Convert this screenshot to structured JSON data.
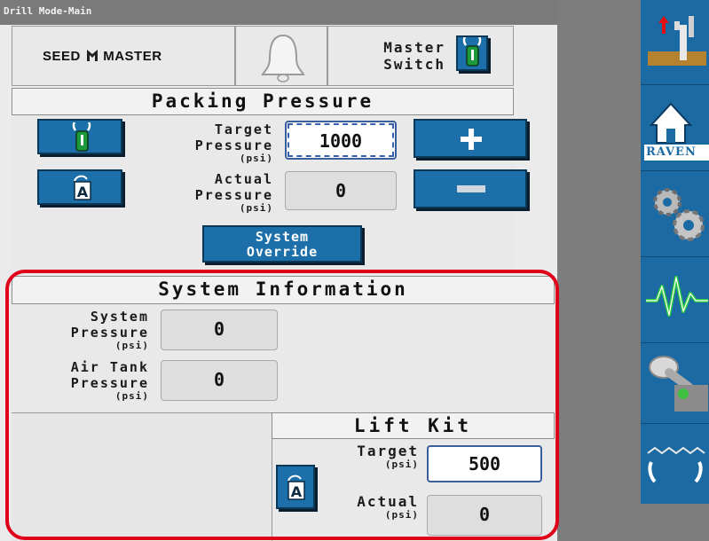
{
  "window": {
    "title": "Drill Mode-Main"
  },
  "header": {
    "brand": "SEEDMASTER",
    "brand_prefix": "SEED",
    "brand_suffix": "MASTER",
    "master_switch_label_line1": "Master",
    "master_switch_label_line2": "Switch"
  },
  "packing": {
    "title": "Packing Pressure",
    "target_label": [
      "Target",
      "Pressure"
    ],
    "target_unit": "(psi)",
    "target_value": "1000",
    "actual_label": [
      "Actual",
      "Pressure"
    ],
    "actual_unit": "(psi)",
    "actual_value": "0",
    "override_line1": "System",
    "override_line2": "Override"
  },
  "system_info": {
    "title": "System Information",
    "system_pressure_label": [
      "System",
      "Pressure"
    ],
    "system_pressure_unit": "(psi)",
    "system_pressure_value": "0",
    "air_tank_label": [
      "Air Tank",
      "Pressure"
    ],
    "air_tank_unit": "(psi)",
    "air_tank_value": "0"
  },
  "lift_kit": {
    "title": "Lift Kit",
    "target_label": "Target",
    "target_unit": "(psi)",
    "target_value": "500",
    "actual_label": "Actual",
    "actual_unit": "(psi)",
    "actual_value": "0"
  },
  "sidebar": {
    "raven_label": "RAVEN",
    "items": [
      "drill-lift-icon",
      "raven-home-icon",
      "gears-icon",
      "diagnostics-icon",
      "joystick-icon",
      "section-control-icon"
    ]
  },
  "colors": {
    "accent_blue": "#1c6fa8",
    "highlight_red": "#e0001a",
    "switch_green": "#1e9a3c"
  }
}
